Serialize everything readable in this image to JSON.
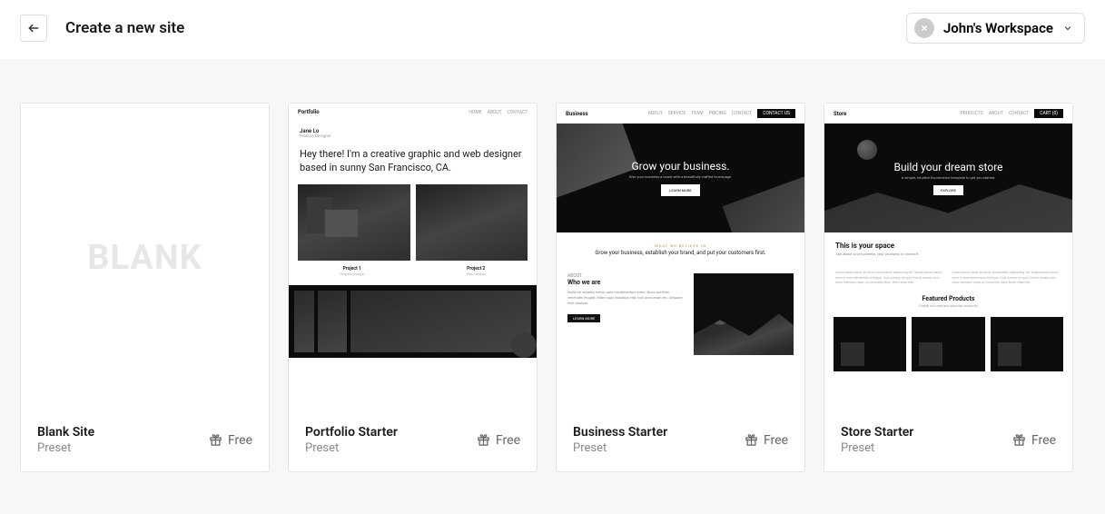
{
  "header": {
    "title": "Create a new site",
    "workspace": "John's Workspace"
  },
  "templates": [
    {
      "title": "Blank Site",
      "subtitle": "Preset",
      "price": "Free",
      "preview": {
        "kind": "blank",
        "word": "BLANK"
      }
    },
    {
      "title": "Portfolio Starter",
      "subtitle": "Preset",
      "price": "Free",
      "preview": {
        "kind": "portfolio",
        "brand": "Portfolio",
        "nav": [
          "HOME",
          "ABOUT",
          "CONTACT"
        ],
        "name": "Jane Lo",
        "role": "Product Designer",
        "headline": "Hey there! I'm a creative graphic and web designer based in sunny San Francisco, CA.",
        "proj1": "Project 1",
        "proj1_sub": "Graphic Design",
        "proj2": "Project 2",
        "proj2_sub": "Web Design"
      }
    },
    {
      "title": "Business Starter",
      "subtitle": "Preset",
      "price": "Free",
      "preview": {
        "kind": "business",
        "brand": "Business",
        "nav": [
          "ABOUT",
          "SERVICE",
          "TEAM",
          "PRICING",
          "CONTACT"
        ],
        "nav_cta": "CONTACT US",
        "hero_title": "Grow your business.",
        "hero_sub": "Give your business a boost with a beautifully crafted homepage.",
        "hero_cta": "LEARN MORE",
        "kicker": "WHAT WE BELIEVE IN",
        "mid": "Grow your business, establish your brand, and put your customers first.",
        "who_k": "ABOUT",
        "who_h": "Who we are",
        "who_p": "Nulla vel sodales tellus, quis condimentum enim. Nunc porttitor venenatis feugiat. Etiam quis faucibus erat, non accumsan leo. Aliquam erat volutpat.",
        "who_cta": "LEARN MORE"
      }
    },
    {
      "title": "Store Starter",
      "subtitle": "Preset",
      "price": "Free",
      "preview": {
        "kind": "store",
        "brand": "Store",
        "nav": [
          "PRODUCTS",
          "ABOUT",
          "CONTACT"
        ],
        "nav_cta": "CART (0)",
        "hero_title": "Build your dream store",
        "hero_sub": "A simple, intuitive Ecommerce template to get you started.",
        "hero_cta": "EXPLORE",
        "ty_h": "This is your space",
        "ty_p": "Talk about your business, your products, or yourself.",
        "lorem": "Lorem ipsum dolor sit amet, consectetur adipiscing elit. Suspendisse varius enim in eros elementum tristique. Duis cursus, mi quis viverra ornare, eros dolor interdum nulla, ut commodo diam libero vitae erat.",
        "feat_h": "Featured Products",
        "feat_p": "Check out new and popular products"
      }
    }
  ]
}
